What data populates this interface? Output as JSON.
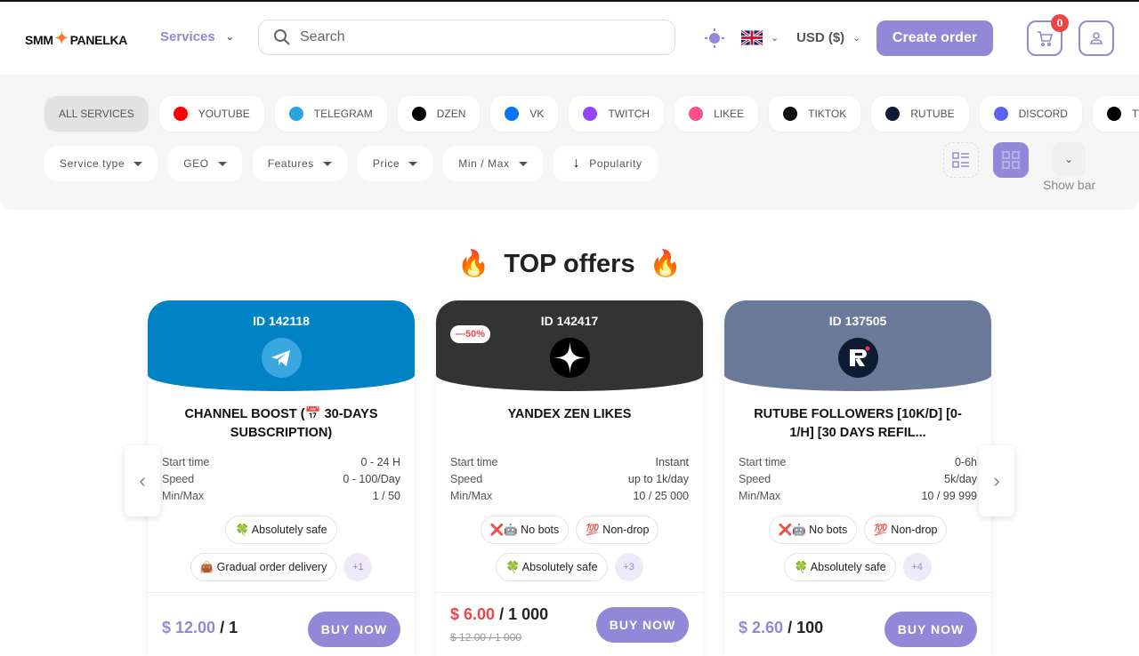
{
  "header": {
    "logo_left": "SMM",
    "logo_right": "PANELKA",
    "services": "Services",
    "search_placeholder": "Search",
    "currency": "USD ($)",
    "create_order": "Create order",
    "cart_count": "0",
    "language": "English (UK flag)"
  },
  "platforms": [
    {
      "label": "ALL SERVICES",
      "active": true
    },
    {
      "label": "YOUTUBE",
      "color": "#ff0000",
      "icon": "youtube-icon"
    },
    {
      "label": "TELEGRAM",
      "color": "#2aa3e0",
      "icon": "telegram-icon"
    },
    {
      "label": "DZEN",
      "color": "#000000",
      "icon": "dzen-icon"
    },
    {
      "label": "VK",
      "color": "#0077ff",
      "icon": "vk-icon"
    },
    {
      "label": "TWITCH",
      "color": "#9146ff",
      "icon": "twitch-icon"
    },
    {
      "label": "LIKEE",
      "color": "#ff4f8b",
      "icon": "likee-icon"
    },
    {
      "label": "TIKTOK",
      "color": "#111111",
      "icon": "tiktok-icon"
    },
    {
      "label": "RUTUBE",
      "color": "#0f1a33",
      "icon": "rutube-icon"
    },
    {
      "label": "DISCORD",
      "color": "#5865f2",
      "icon": "discord-icon"
    },
    {
      "label": "TWITTER",
      "color": "#000000",
      "icon": "x-icon"
    }
  ],
  "filters": [
    "Service type",
    "GEO",
    "Features",
    "Price",
    "Min / Max"
  ],
  "sort": "Popularity",
  "show_bar": "Show bar",
  "section_title": "TOP offers",
  "labels": {
    "start": "Start time",
    "speed": "Speed",
    "minmax": "Min/Max",
    "buy": "BUY NOW"
  },
  "offers": [
    {
      "id": "ID 142118",
      "color": "#0083c5",
      "name": "CHANNEL BOOST (📅 30-DAYS SUBSCRIPTION)",
      "start": "0 - 24 H",
      "speed": "0 - 100/Day",
      "minmax": "1 / 50",
      "tags": [
        "🍀 Absolutely safe",
        "👜 Gradual order delivery"
      ],
      "more": "+1",
      "price": "$ 12.00",
      "per": "/ 1"
    },
    {
      "id": "ID 142417",
      "color": "#333333",
      "discount": "—50%",
      "name": "YANDEX ZEN LIKES",
      "start": "Instant",
      "speed": "up to 1k/day",
      "minmax": "10 / 25 000",
      "tags": [
        "❌🤖 No bots",
        "💯 Non-drop",
        "🍀 Absolutely safe"
      ],
      "more": "+3",
      "price": "$ 6.00",
      "per": "/ 1 000",
      "old_price": "$ 12.00 / 1 000"
    },
    {
      "id": "ID 137505",
      "color": "#6a7a98",
      "name": "RUTUBE FOLLOWERS [10K/D] [0-1/H] [30 DAYS REFIL...",
      "start": "0-6h",
      "speed": "5k/day",
      "minmax": "10 / 99 999",
      "tags": [
        "❌🤖 No bots",
        "💯 Non-drop",
        "🍀 Absolutely safe"
      ],
      "more": "+4",
      "price": "$ 2.60",
      "per": "/ 100"
    }
  ]
}
